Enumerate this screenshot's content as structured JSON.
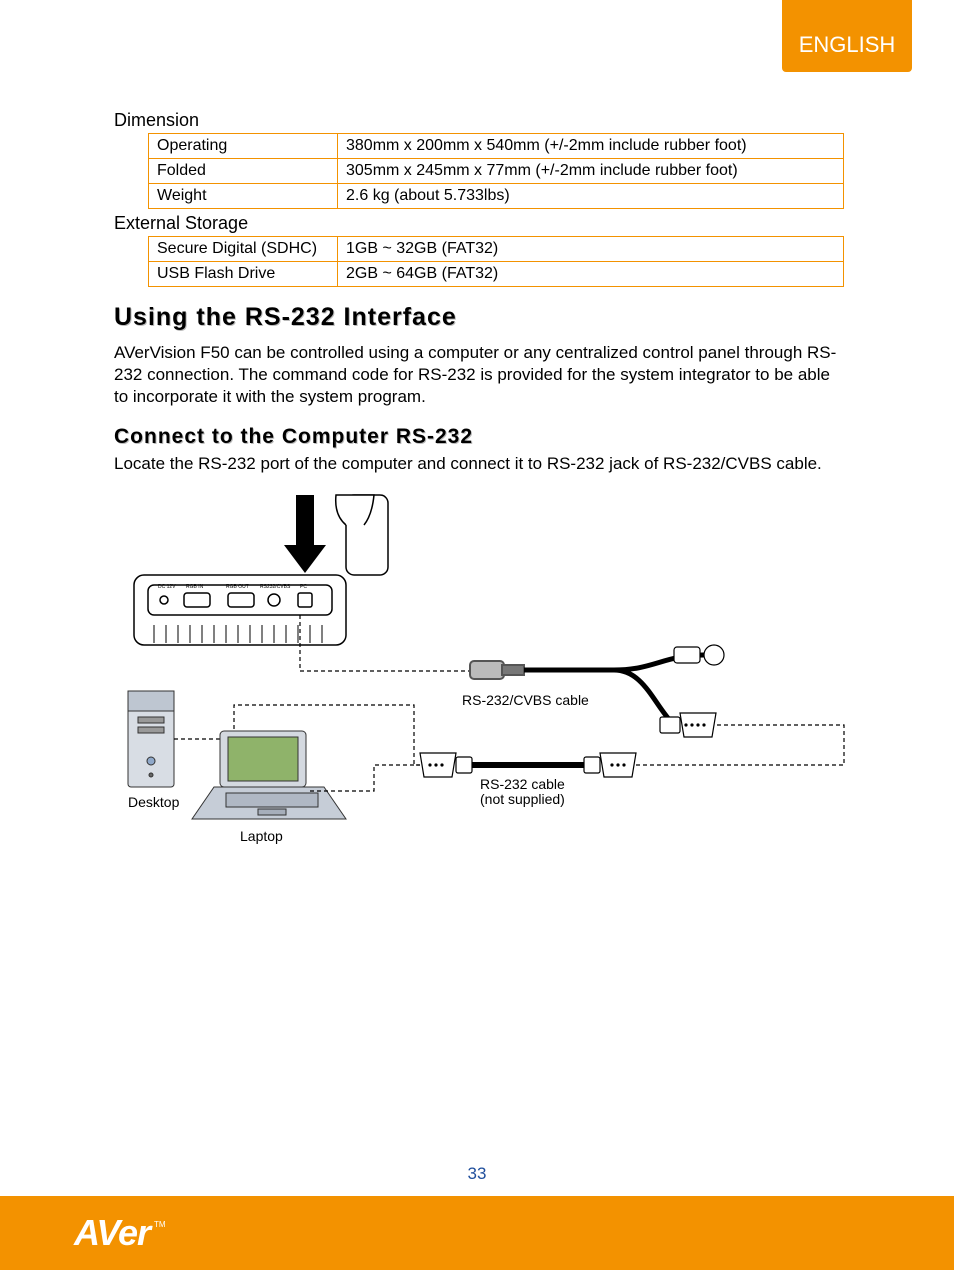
{
  "language_tab": "ENGLISH",
  "sections": {
    "dimension": {
      "title": "Dimension",
      "rows": [
        {
          "label": "Operating",
          "value": "380mm x 200mm x 540mm (+/-2mm include rubber foot)"
        },
        {
          "label": "Folded",
          "value": "305mm x 245mm x 77mm (+/-2mm include rubber foot)"
        },
        {
          "label": "Weight",
          "value": "2.6 kg (about 5.733lbs)"
        }
      ]
    },
    "external_storage": {
      "title": "External Storage",
      "rows": [
        {
          "label": "Secure Digital (SDHC)",
          "value": "1GB ~ 32GB (FAT32)"
        },
        {
          "label": "USB Flash Drive",
          "value": "2GB ~ 64GB (FAT32)"
        }
      ]
    }
  },
  "heading_rs232": "Using the RS-232 Interface",
  "para_rs232": "AVerVision F50 can be controlled using a computer or any centralized control panel through RS-232 connection.  The command code for RS-232 is provided for the system integrator to be able to incorporate it with the system program.",
  "heading_connect": "Connect to the Computer RS-232",
  "para_connect": "Locate the RS-232 port of the computer and connect it to RS-232 jack of RS-232/CVBS cable.",
  "diagram": {
    "desktop": "Desktop",
    "laptop": "Laptop",
    "cable1": "RS-232/CVBS cable",
    "cable2_line1": "RS-232 cable",
    "cable2_line2": "(not supplied)",
    "ports": {
      "dc": "DC 12V",
      "rgb_in": "RGB IN",
      "rgb_out": "RGB OUT",
      "rs232": "RS232/CVBS",
      "pc": "PC"
    }
  },
  "page_number": "33",
  "logo": {
    "text": "AVer",
    "tm": "TM"
  }
}
